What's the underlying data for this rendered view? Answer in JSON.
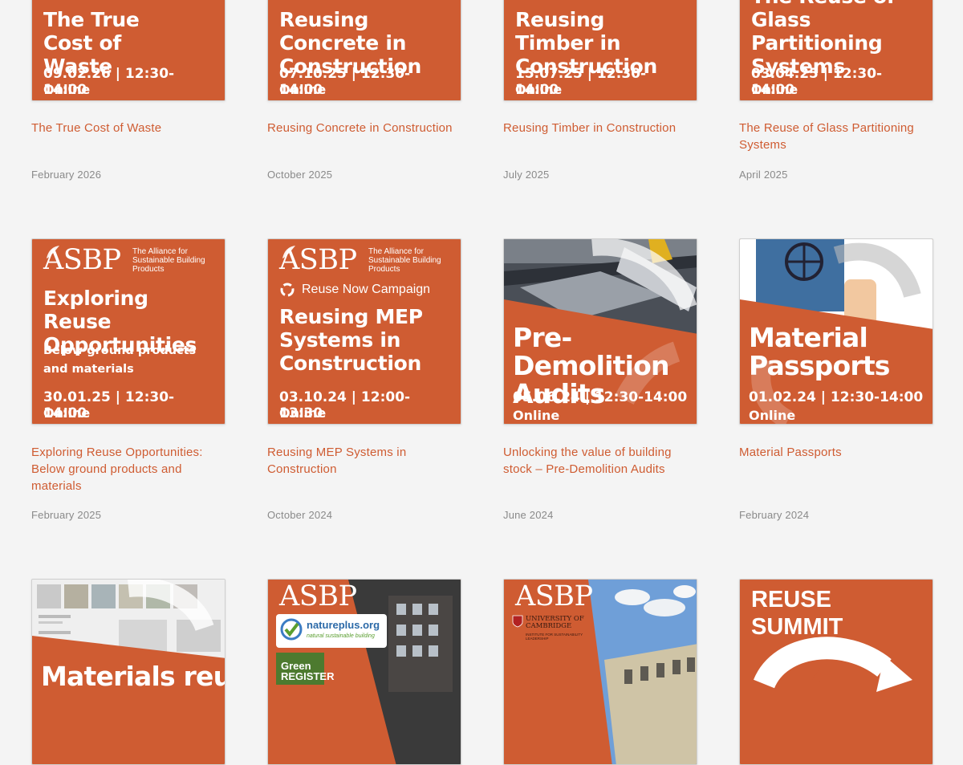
{
  "brand": {
    "accent": "#cf5c32",
    "background": "#f4f4f4",
    "date_color": "#8a8a8a"
  },
  "events": [
    {
      "thumb_title": "The True Cost of Waste",
      "date_line": "09.02.26 | 12:30-14:00",
      "mode": "Online",
      "title": "The True Cost of Waste",
      "date": "February 2026"
    },
    {
      "thumb_title": "Reusing Concrete in Construction",
      "date_line": "07.10.25 | 12:30-14:00",
      "mode": "Online",
      "title": "Reusing Concrete in Construction",
      "date": "October 2025"
    },
    {
      "thumb_title": "Reusing Timber in Construction",
      "date_line": "15.07.25 | 12:30-14:00",
      "mode": "Online",
      "title": "Reusing Timber in Construction",
      "date": "July 2025"
    },
    {
      "thumb_title": "The Reuse of Glass Partitioning Systems",
      "date_line": "03.04.25 | 12:30-14:00",
      "mode": "Online",
      "title": "The Reuse of Glass Partitioning Systems",
      "date": "April 2025"
    },
    {
      "logo": "ASBP",
      "logo_sub": "The Alliance for Sustainable Building Products",
      "thumb_title": "Exploring Reuse Opportunities",
      "subtitle": "Below ground products and materials",
      "date_line": "30.01.25 | 12:30-14:00",
      "mode": "Online",
      "title": "Exploring Reuse Opportunities: Below ground products and materials",
      "date": "February 2025"
    },
    {
      "logo": "ASBP",
      "logo_sub": "The Alliance for Sustainable Building Products",
      "campaign": "Reuse Now Campaign",
      "thumb_title": "Reusing MEP Systems in Construction",
      "date_line": "03.10.24 | 12:00-13:30",
      "mode": "Online",
      "title": "Reusing MEP Systems in Construction",
      "date": "October 2024"
    },
    {
      "thumb_title": "Pre-Demolition Audits",
      "date_line": "05.06.24 | 12:30-14:00",
      "mode": "Online",
      "title": "Unlocking the value of building stock – Pre-Demolition Audits",
      "date": "June 2024"
    },
    {
      "thumb_title": "Material Passports",
      "date_line": "01.02.24 | 12:30-14:00",
      "mode": "Online",
      "title": "Material Passports",
      "date": "February 2024"
    },
    {
      "thumb_title": "Materials reuse"
    },
    {
      "logo": "ASBP",
      "badge_1": "natureplus.org",
      "badge_1_sub": "natural sustainable building",
      "badge_2": "Green REGISTER"
    },
    {
      "logo": "ASBP",
      "univ_name": "UNIVERSITY OF CAMBRIDGE",
      "univ_sub": "INSTITUTE FOR SUSTAINABILITY LEADERSHIP"
    },
    {
      "thumb_title": "REUSE SUMMIT"
    }
  ]
}
